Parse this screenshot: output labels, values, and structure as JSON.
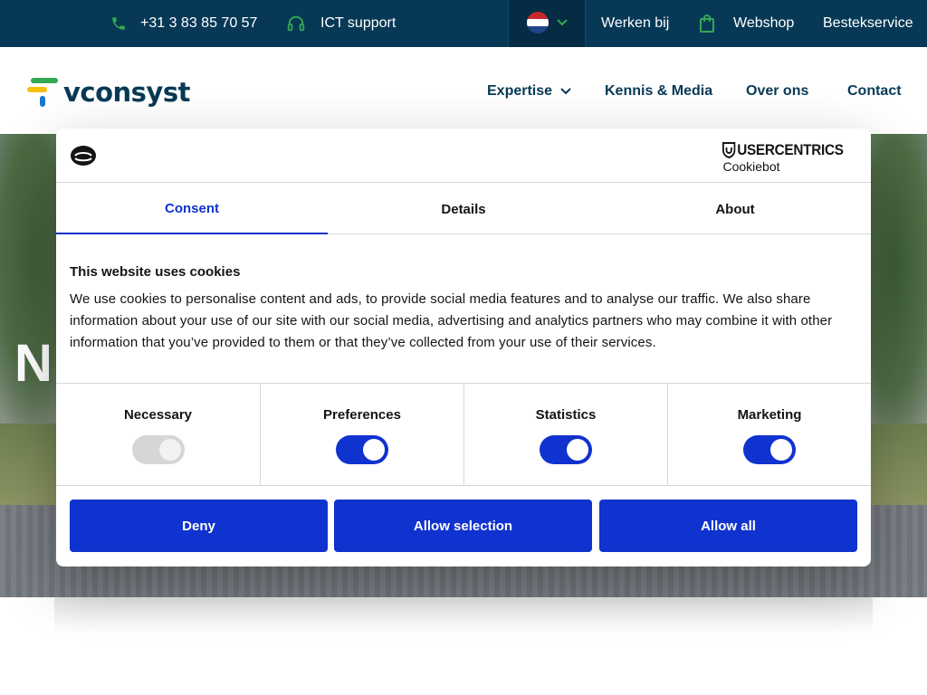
{
  "topbar": {
    "phone": "+31 3 83 85 70 57",
    "support": "ICT support",
    "links": {
      "careers": "Werken bij",
      "webshop": "Webshop",
      "bestek": "Bestekservice"
    },
    "icon_color": "#34a853"
  },
  "header": {
    "logo_text": "vconsyst",
    "nav": [
      {
        "label": "Expertise"
      },
      {
        "label": "Kennis & Media"
      },
      {
        "label": "Over ons"
      },
      {
        "label": "Contact"
      }
    ]
  },
  "hero": {
    "title_partial": "N"
  },
  "cookie_dialog": {
    "brand": "USERCENTRICS",
    "brand_sub": "Cookiebot",
    "tabs": [
      "Consent",
      "Details",
      "About"
    ],
    "active_tab": "Consent",
    "title": "This website uses cookies",
    "body": "We use cookies to personalise content and ads, to provide social media features and to analyse our traffic. We also share information about your use of our site with our social media, advertising and analytics partners who may combine it with other information that you’ve provided to them or that they’ve collected from your use of their services.",
    "categories": [
      {
        "label": "Necessary",
        "enabled": true,
        "disabled": true
      },
      {
        "label": "Preferences",
        "enabled": true
      },
      {
        "label": "Statistics",
        "enabled": true
      },
      {
        "label": "Marketing",
        "enabled": true
      }
    ],
    "buttons": {
      "deny": "Deny",
      "allow_selection": "Allow selection",
      "allow_all": "Allow all"
    },
    "accent_color": "#1032cf"
  }
}
